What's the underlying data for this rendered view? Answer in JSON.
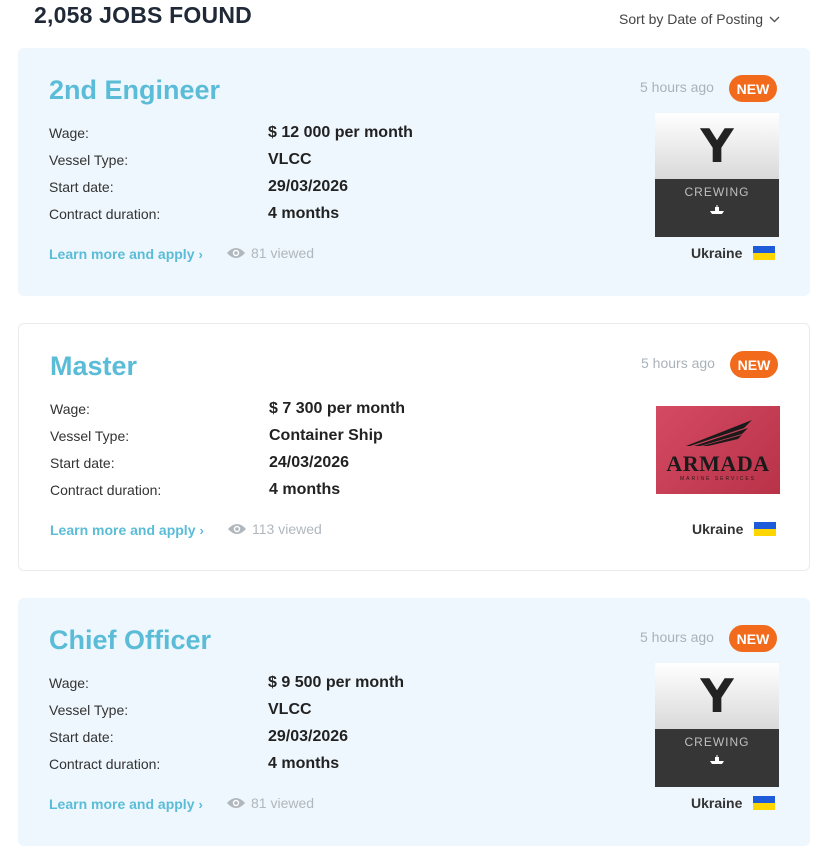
{
  "header": {
    "jobs_found": "2,058 JOBS FOUND",
    "sort_label": "Sort by Date of Posting"
  },
  "labels": {
    "wage": "Wage:",
    "vessel_type": "Vessel Type:",
    "start_date": "Start date:",
    "contract_duration": "Contract duration:",
    "apply": "Learn more and apply",
    "new_badge": "NEW"
  },
  "jobs": [
    {
      "title": "2nd Engineer",
      "wage": "$ 12 000 per month",
      "vessel_type": "VLCC",
      "start_date": "29/03/2026",
      "contract_duration": "4 months",
      "views": "81 viewed",
      "posted": "5 hours ago",
      "country": "Ukraine",
      "logo": {
        "type": "y-crewing",
        "letter": "Y",
        "text": "CREWING"
      }
    },
    {
      "title": "Master",
      "wage": "$ 7 300 per month",
      "vessel_type": "Container Ship",
      "start_date": "24/03/2026",
      "contract_duration": "4 months",
      "views": "113 viewed",
      "posted": "5 hours ago",
      "country": "Ukraine",
      "logo": {
        "type": "armada",
        "text": "ARMADA",
        "subtext": "MARINE SERVICES"
      }
    },
    {
      "title": "Chief Officer",
      "wage": "$ 9 500 per month",
      "vessel_type": "VLCC",
      "start_date": "29/03/2026",
      "contract_duration": "4 months",
      "views": "81 viewed",
      "posted": "5 hours ago",
      "country": "Ukraine",
      "logo": {
        "type": "y-crewing",
        "letter": "Y",
        "text": "CREWING"
      }
    }
  ],
  "colors": {
    "accent": "#5bbcd8",
    "badge": "#f26b1d",
    "card_tint": "#eef7fd",
    "muted": "#aab2b9"
  }
}
